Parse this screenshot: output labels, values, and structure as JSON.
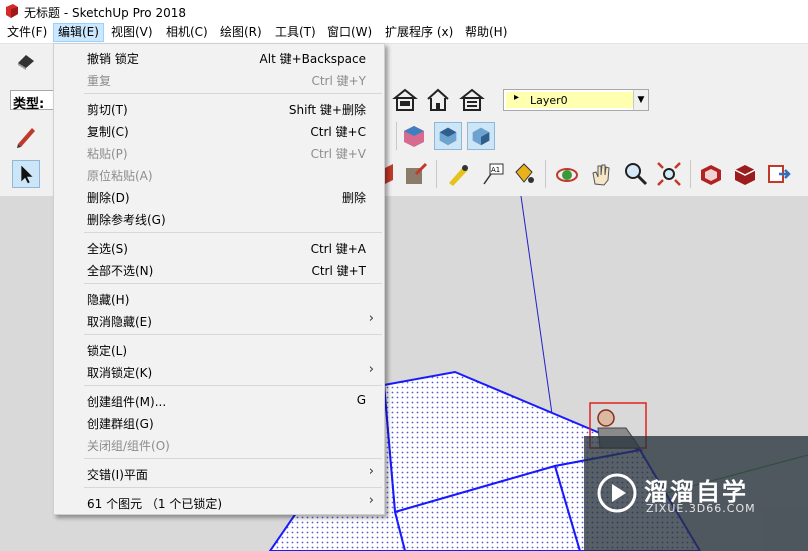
{
  "window": {
    "title": "无标题 - SketchUp Pro 2018"
  },
  "menubar": {
    "items": [
      {
        "label": "文件(F)"
      },
      {
        "label": "编辑(E)"
      },
      {
        "label": "视图(V)"
      },
      {
        "label": "相机(C)"
      },
      {
        "label": "绘图(R)"
      },
      {
        "label": "工具(T)"
      },
      {
        "label": "窗口(W)"
      },
      {
        "label": "扩展程序 (x)"
      },
      {
        "label": "帮助(H)"
      }
    ],
    "active_index": 1
  },
  "toolbar": {
    "type_label": "类型:",
    "layer": {
      "selected": "Layer0"
    }
  },
  "edit_menu": {
    "items": [
      {
        "label": "撤销 锁定",
        "shortcut": "Alt 键+Backspace",
        "disabled": false
      },
      {
        "label": "重复",
        "shortcut": "Ctrl 键+Y",
        "disabled": true
      },
      {
        "label": "剪切(T)",
        "shortcut": "Shift 键+删除",
        "disabled": false
      },
      {
        "label": "复制(C)",
        "shortcut": "Ctrl 键+C",
        "disabled": false
      },
      {
        "label": "粘贴(P)",
        "shortcut": "Ctrl 键+V",
        "disabled": true
      },
      {
        "label": "原位粘贴(A)",
        "shortcut": "",
        "disabled": true
      },
      {
        "label": "删除(D)",
        "shortcut": "删除",
        "disabled": false
      },
      {
        "label": "删除参考线(G)",
        "shortcut": "",
        "disabled": false
      },
      {
        "label": "全选(S)",
        "shortcut": "Ctrl 键+A",
        "disabled": false
      },
      {
        "label": "全部不选(N)",
        "shortcut": "Ctrl 键+T",
        "disabled": false
      },
      {
        "label": "隐藏(H)",
        "shortcut": "",
        "disabled": false
      },
      {
        "label": "取消隐藏(E)",
        "shortcut": "",
        "submenu": true,
        "disabled": false
      },
      {
        "label": "锁定(L)",
        "shortcut": "",
        "disabled": false
      },
      {
        "label": "取消锁定(K)",
        "shortcut": "",
        "submenu": true,
        "disabled": false
      },
      {
        "label": "创建组件(M)...",
        "shortcut": "G",
        "disabled": false
      },
      {
        "label": "创建群组(G)",
        "shortcut": "",
        "disabled": false
      },
      {
        "label": "关闭组/组件(O)",
        "shortcut": "",
        "disabled": true
      },
      {
        "label": "交错(I)平面",
        "shortcut": "",
        "submenu": true,
        "disabled": false
      },
      {
        "label": "61 个图元 （1 个已锁定)",
        "shortcut": "",
        "submenu": true,
        "disabled": false
      }
    ],
    "submenu_arrow": "›"
  },
  "watermark": {
    "title": "溜溜自学",
    "subtitle": "ZIXUE.3D66.COM"
  },
  "colors": {
    "accent_arrow": "#e0221c",
    "model_edge": "#1a1aff",
    "axis_green": "#3cb043",
    "axis_blue": "#2020c8"
  }
}
